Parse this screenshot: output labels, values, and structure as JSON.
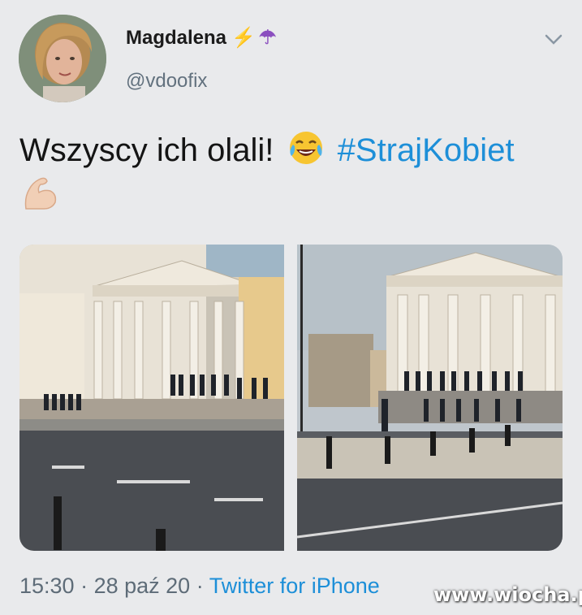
{
  "author": {
    "display_name": "Magdalena",
    "name_emojis": [
      "⚡",
      "☂"
    ],
    "handle": "@vdoofix"
  },
  "tweet": {
    "text": "Wszyscy ich olali!",
    "hashtag": "#StrajKobiet"
  },
  "footer": {
    "time": "15:30",
    "separator1": " · ",
    "date": "28 paź 20",
    "separator2": " · ",
    "source": "Twitter for iPhone"
  },
  "watermark": "www.wiocha.pl",
  "colors": {
    "background": "#e9eaec",
    "link": "#1d8fd8",
    "secondary_text": "#5e6c78"
  },
  "icons": {
    "more": "chevron-down-icon",
    "laughing": "face-with-tears-of-joy-icon",
    "muscle": "flexed-biceps-icon"
  }
}
